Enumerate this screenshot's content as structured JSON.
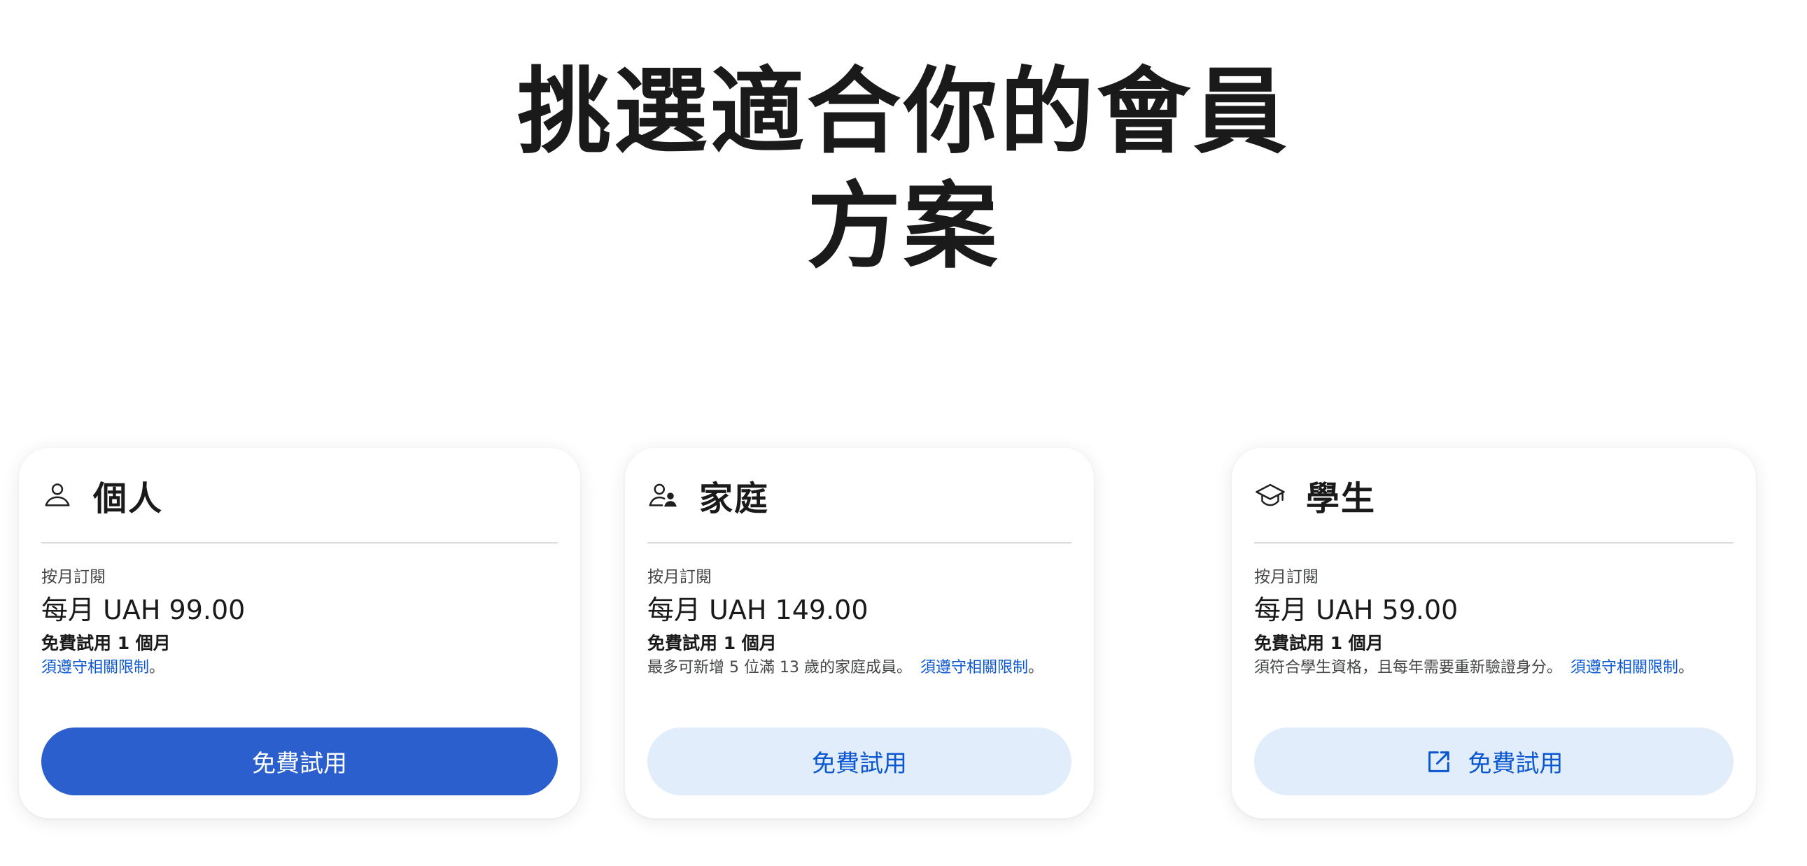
{
  "page": {
    "title_line1": "挑選適合你的會員",
    "title_line2": "方案"
  },
  "plans": [
    {
      "icon": "person-icon",
      "name": "個人",
      "billing_label": "按月訂閱",
      "price": "每月 UAH 99.00",
      "trial": "免費試用 1 個月",
      "note_text": "",
      "restrictions_link": "須遵守相關限制",
      "note_end": "。",
      "cta_label": "免費試用",
      "cta_style": "primary"
    },
    {
      "icon": "family-icon",
      "name": "家庭",
      "billing_label": "按月訂閱",
      "price": "每月 UAH 149.00",
      "trial": "免費試用 1 個月",
      "note_text": "最多可新增 5 位滿 13 歲的家庭成員。",
      "restrictions_link": "須遵守相關限制",
      "note_end": "。",
      "cta_label": "免費試用",
      "cta_style": "tonal"
    },
    {
      "icon": "graduation-cap-icon",
      "name": "學生",
      "billing_label": "按月訂閱",
      "price": "每月 UAH 59.00",
      "trial": "免費試用 1 個月",
      "note_text": "須符合學生資格，且每年需要重新驗證身分。",
      "restrictions_link": "須遵守相關限制",
      "note_end": "。",
      "cta_label": "免費試用",
      "cta_style": "tonal",
      "cta_icon": "open-in-new-icon"
    }
  ],
  "colors": {
    "primary_button": "#2b5fce",
    "tonal_button": "#e1edfb",
    "link": "#0b57d0"
  }
}
